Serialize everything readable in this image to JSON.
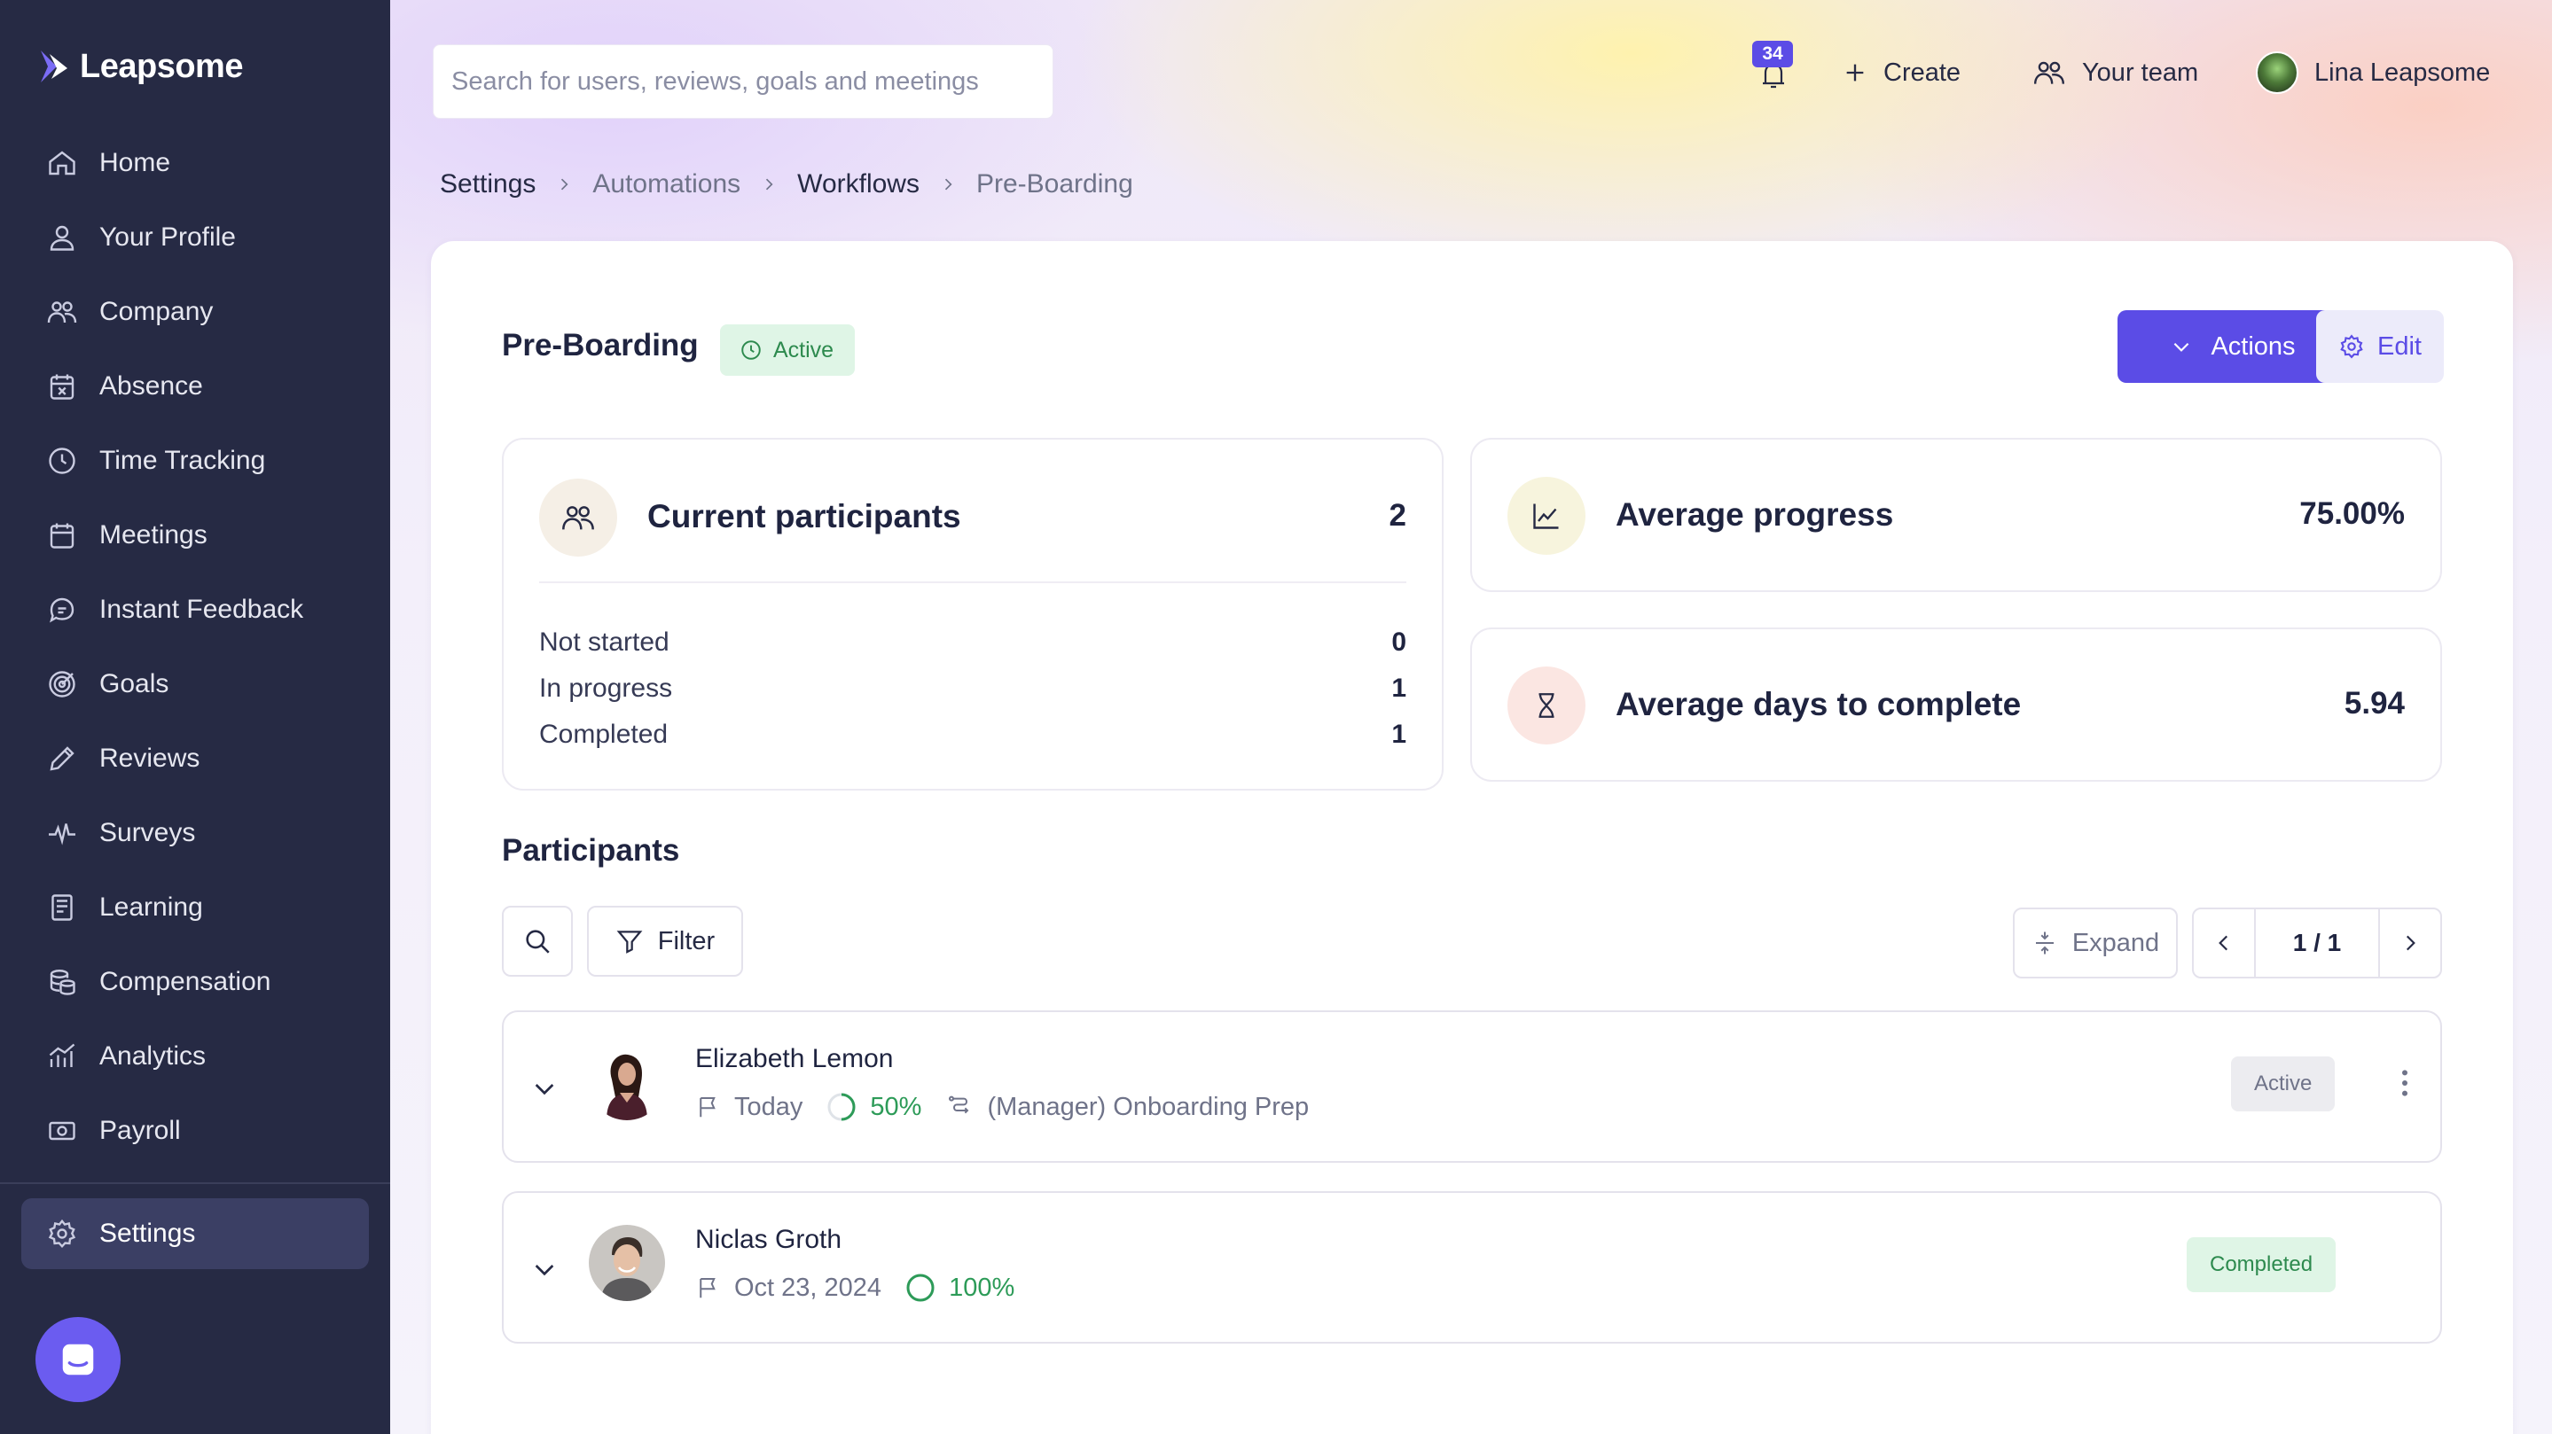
{
  "brand": {
    "name": "Leapsome"
  },
  "sidebar": {
    "items": [
      {
        "label": "Home",
        "icon": "home-icon"
      },
      {
        "label": "Your Profile",
        "icon": "user-icon"
      },
      {
        "label": "Company",
        "icon": "people-icon"
      },
      {
        "label": "Absence",
        "icon": "calendar-x-icon"
      },
      {
        "label": "Time Tracking",
        "icon": "clock-icon"
      },
      {
        "label": "Meetings",
        "icon": "calendar-icon"
      },
      {
        "label": "Instant Feedback",
        "icon": "chat-icon"
      },
      {
        "label": "Goals",
        "icon": "target-icon"
      },
      {
        "label": "Reviews",
        "icon": "pencil-icon"
      },
      {
        "label": "Surveys",
        "icon": "pulse-icon"
      },
      {
        "label": "Learning",
        "icon": "book-icon"
      },
      {
        "label": "Compensation",
        "icon": "coins-icon"
      },
      {
        "label": "Analytics",
        "icon": "chart-icon"
      },
      {
        "label": "Payroll",
        "icon": "banknote-icon"
      }
    ],
    "settings": {
      "label": "Settings",
      "icon": "gear-icon"
    }
  },
  "topbar": {
    "search_placeholder": "Search for users, reviews, goals and meetings",
    "notifications_count": "34",
    "create_label": "Create",
    "team_label": "Your team",
    "user_name": "Lina Leapsome"
  },
  "breadcrumb": {
    "items": [
      "Settings",
      "Automations",
      "Workflows",
      "Pre-Boarding"
    ]
  },
  "workflow": {
    "title": "Pre-Boarding",
    "status": "Active",
    "actions_label": "Actions",
    "edit_label": "Edit"
  },
  "stats": {
    "participants": {
      "title": "Current participants",
      "value": "2",
      "rows": [
        {
          "label": "Not started",
          "value": "0"
        },
        {
          "label": "In progress",
          "value": "1"
        },
        {
          "label": "Completed",
          "value": "1"
        }
      ]
    },
    "progress": {
      "title": "Average progress",
      "value": "75.00%"
    },
    "days": {
      "title": "Average days to complete",
      "value": "5.94"
    }
  },
  "participants_section": {
    "title": "Participants",
    "filter_label": "Filter",
    "expand_label": "Expand",
    "pagination": "1 / 1",
    "rows": [
      {
        "name": "Elizabeth Lemon",
        "date": "Today",
        "progress": "50%",
        "progress_value": 0.5,
        "step": "(Manager) Onboarding Prep",
        "status": "Active"
      },
      {
        "name": "Niclas Groth",
        "date": "Oct 23, 2024",
        "progress": "100%",
        "progress_value": 1.0,
        "step": "",
        "status": "Completed"
      }
    ]
  },
  "colors": {
    "sidebar_bg": "#262a44",
    "accent": "#5b4ce6",
    "success": "#2d9b58",
    "success_bg": "#dff5e6"
  }
}
